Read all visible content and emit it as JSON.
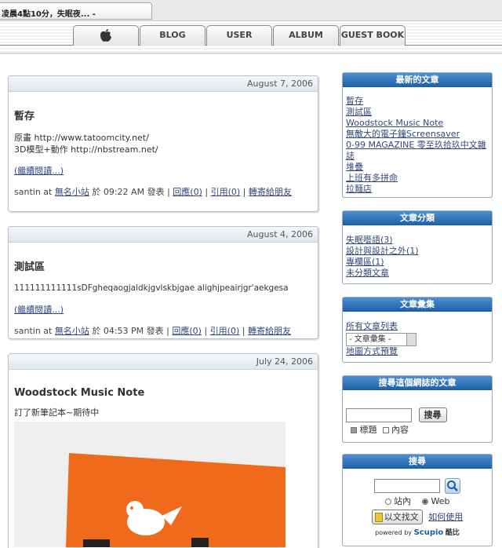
{
  "browser": {
    "tab_title": "凌晨4點10分，失眠夜... -"
  },
  "nav": {
    "tabs": [
      {
        "label": "",
        "icon": "apple-icon"
      },
      {
        "label": "BLOG"
      },
      {
        "label": "USER"
      },
      {
        "label": "ALBUM"
      },
      {
        "label": "GUEST BOOK"
      }
    ]
  },
  "posts": [
    {
      "date": "August 7, 2006",
      "title": "暫存",
      "lines": [
        "原畫 http://www.tatoomcity.net/",
        "3D模型+動作 http://nbstream.net/"
      ],
      "more": "(繼續閱讀...)",
      "meta": {
        "author": "santin",
        "at": "at",
        "site": "無名小站",
        "time": "於 09:22 AM 發表",
        "reply": "回應(0)",
        "cite": "引用(0)",
        "forward": "轉寄給朋友"
      }
    },
    {
      "date": "August 4, 2006",
      "title": "測試區",
      "lines": [
        "111111111111sDFgheqaogjaldkjgvlskbjgae alighjpeairjgr'aekgesa"
      ],
      "more": "(繼續閱讀...)",
      "meta": {
        "author": "santin",
        "at": "at",
        "site": "無名小站",
        "time": "於 04:53 PM 發表",
        "reply": "回應(0)",
        "cite": "引用(0)",
        "forward": "轉寄給朋友"
      }
    },
    {
      "date": "July 24, 2006",
      "title": "Woodstock Music Note",
      "lines": [
        "訂了新筆記本~期待中"
      ]
    }
  ],
  "sidebar": {
    "latest": {
      "title": "最新的文章",
      "items": [
        "暫存",
        "測試區",
        "Woodstock Music Note",
        "無敵大的電子鐘Screensaver",
        "0-99 MAGAZINE 零至玖拾玖中文雜誌",
        "堆疊",
        "上班有多拼命",
        "拉麵店"
      ]
    },
    "categories": {
      "title": "文章分類",
      "items": [
        "失眠囈語(3)",
        "設計與設計之外(1)",
        "專欄區(1)",
        "未分類文章"
      ]
    },
    "archive": {
      "title": "文章彙集",
      "all_link": "所有文章列表",
      "select_value": "- 文章彙集 -",
      "map_link": "地圖方式預覽"
    },
    "blog_search": {
      "title": "搜尋這個網誌的文章",
      "button": "搜尋",
      "opt_title": "標題",
      "opt_content": "內容"
    },
    "web_search": {
      "title": "搜尋",
      "opt_site": "站內",
      "opt_web": "Web",
      "find_button": "以文找文",
      "howto": "如何使用",
      "powered": "powered by",
      "brand": "Scupio",
      "brand_suffix": "酷比"
    }
  }
}
